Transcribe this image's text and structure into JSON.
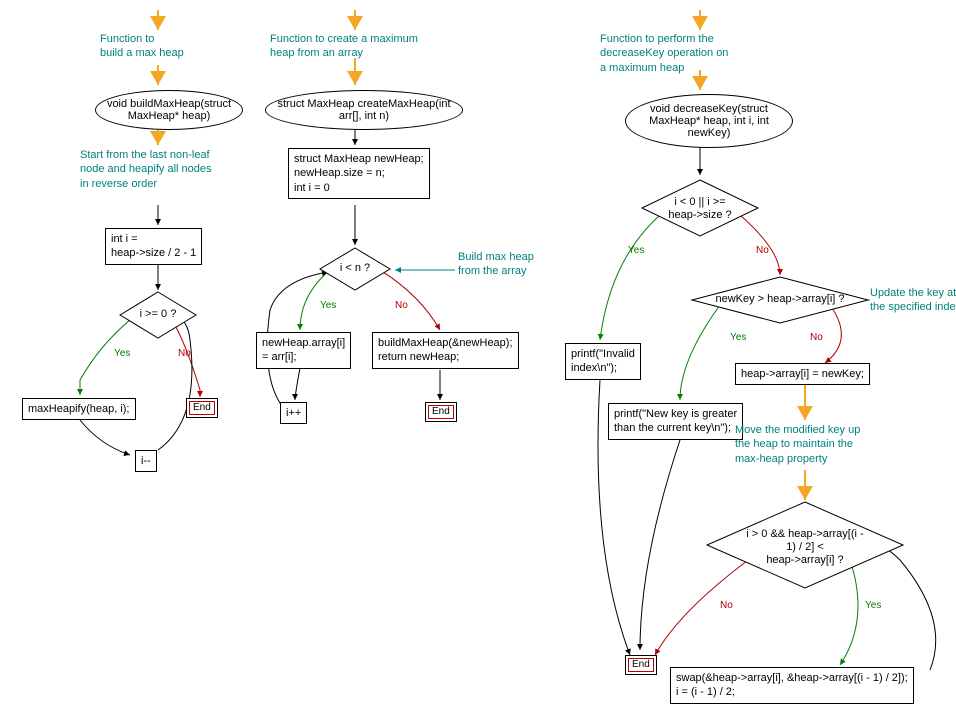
{
  "flow1": {
    "comment_top": "Function to\nbuild a max heap",
    "terminal": "void buildMaxHeap(struct\nMaxHeap* heap)",
    "comment_mid": "Start from the last non-leaf\nnode and heapify all nodes\nin reverse order",
    "process_init": "int i =\nheap->size / 2 - 1",
    "decision": "i >= 0 ?",
    "yes": "Yes",
    "no": "No",
    "process_body": "maxHeapify(heap, i);",
    "process_step": "i--",
    "end": "End"
  },
  "flow2": {
    "comment_top": "Function to create a maximum\nheap from an array",
    "terminal": "struct MaxHeap createMaxHeap(int\narr[], int n)",
    "process_init": "struct MaxHeap newHeap;\nnewHeap.size = n;\nint i = 0",
    "decision": "i < n ?",
    "yes": "Yes",
    "no": "No",
    "comment_build": "Build max heap\nfrom the array",
    "process_body": "newHeap.array[i]\n= arr[i];",
    "process_no": "buildMaxHeap(&newHeap);\nreturn newHeap;",
    "process_step": "i++",
    "end": "End"
  },
  "flow3": {
    "comment_top": "Function to perform the\ndecreaseKey operation on\na maximum heap",
    "terminal": "void decreaseKey(struct\nMaxHeap* heap, int i, int\nnewKey)",
    "decision1": "i < 0 || i >=\nheap->size ?",
    "yes": "Yes",
    "no": "No",
    "process_invalid": "printf(\"Invalid\nindex\\n\");",
    "decision2": "newKey > heap->array[i] ?",
    "comment_update": "Update the key at\nthe specified index",
    "process_greater": "printf(\"New key is greater\nthan the current key\\n\");",
    "process_assign": "heap->array[i] = newKey;",
    "comment_move": "Move the modified key up\nthe heap to maintain the\nmax-heap property",
    "decision3": "i > 0 && heap->array[(i -\n1) / 2] <\nheap->array[i] ?",
    "process_swap": "swap(&heap->array[i], &heap->array[(i - 1) / 2]);\ni = (i - 1) / 2;",
    "end": "End"
  }
}
